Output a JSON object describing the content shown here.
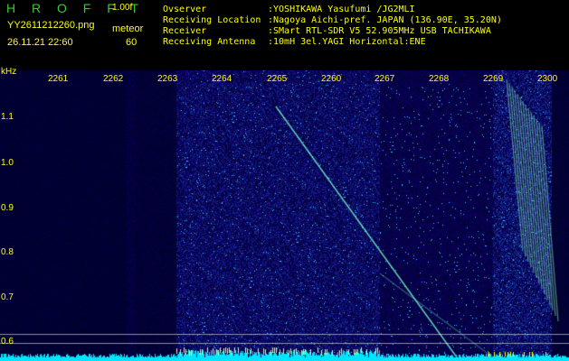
{
  "header": {
    "brand": "H R O F F T",
    "version": "1.00f",
    "filename": "YY2611212260.png",
    "datetime": "26.11.21 22:60",
    "meteor_label": "meteor",
    "meteor_count": "60"
  },
  "info": [
    {
      "key": "Ovserver",
      "value": ":YOSHIKAWA Yasufumi /JG2MLI"
    },
    {
      "key": "Receiving Location",
      "value": ":Nagoya Aichi-pref. JAPAN (136.90E, 35.20N)"
    },
    {
      "key": "Receiver",
      "value": ":SMart RTL-SDR V5 52.905MHz USB TACHIKAWA"
    },
    {
      "key": "Receiving Antenna",
      "value": ":10mH 3el.YAGI Horizontal:ENE"
    }
  ],
  "axes": {
    "y_unit": "kHz",
    "y_ticks": [
      "1.1",
      "1.0",
      "0.9",
      "0.8",
      "0.7",
      "0.6"
    ],
    "x_ticks": [
      "2261",
      "2262",
      "2263",
      "2264",
      "2265",
      "2260",
      "2267",
      "2268",
      "2269",
      "2300"
    ]
  },
  "colors": {
    "label": "#ffff00",
    "brand": "#33cc33",
    "noise_low": "#000066",
    "noise_high": "#33ccff",
    "signal": "#66ffcc",
    "baseline": "#00ffff"
  }
}
